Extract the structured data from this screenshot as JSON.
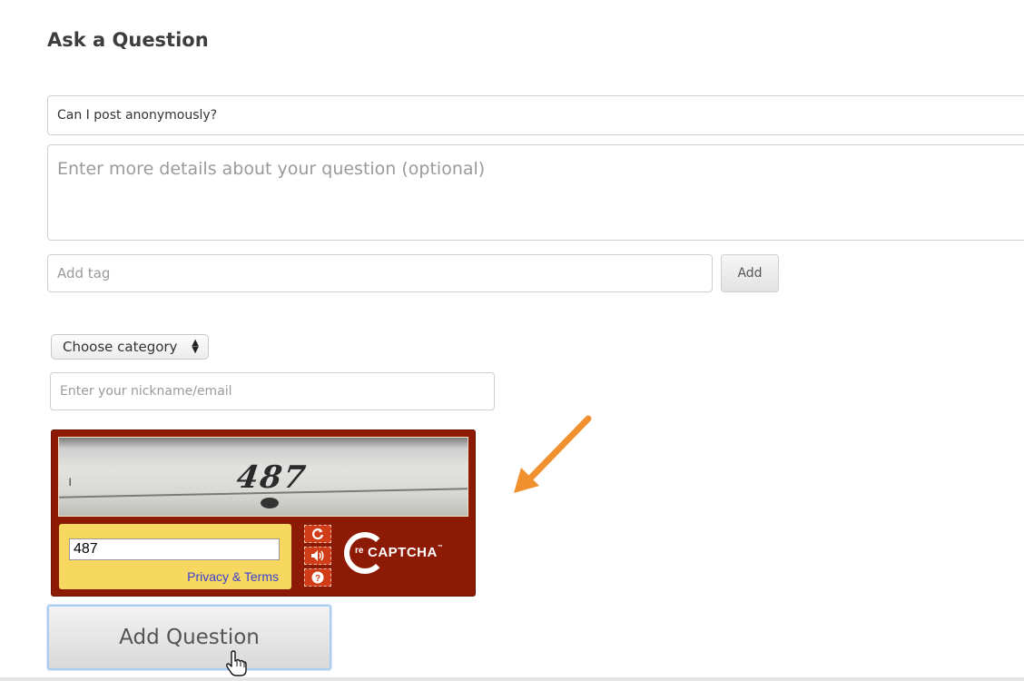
{
  "form": {
    "title": "Ask a Question",
    "question_title_value": "Can I post anonymously?",
    "details_placeholder": "Enter more details about your question (optional)",
    "tag_placeholder": "Add tag",
    "add_tag_label": "Add",
    "category_label": "Choose category",
    "nickname_placeholder": "Enter your nickname/email",
    "submit_label": "Add Question"
  },
  "recaptcha": {
    "challenge_text": "487",
    "answer_value": "487",
    "privacy_link": "Privacy & Terms",
    "logo_prefix": "re",
    "logo_text": "CAPTCHA",
    "logo_tm": "™",
    "buttons": [
      "refresh-icon",
      "audio-icon",
      "help-icon"
    ],
    "colors": {
      "frame": "#8d1a05",
      "answer_box": "#f6d760",
      "button": "#d13c18"
    }
  },
  "annotation": {
    "arrow_color": "#f0902e",
    "arrow_icon": "arrow-pointer-icon"
  },
  "colors": {
    "field_border": "#cfcfcf",
    "submit_focus": "#a9cdef"
  }
}
